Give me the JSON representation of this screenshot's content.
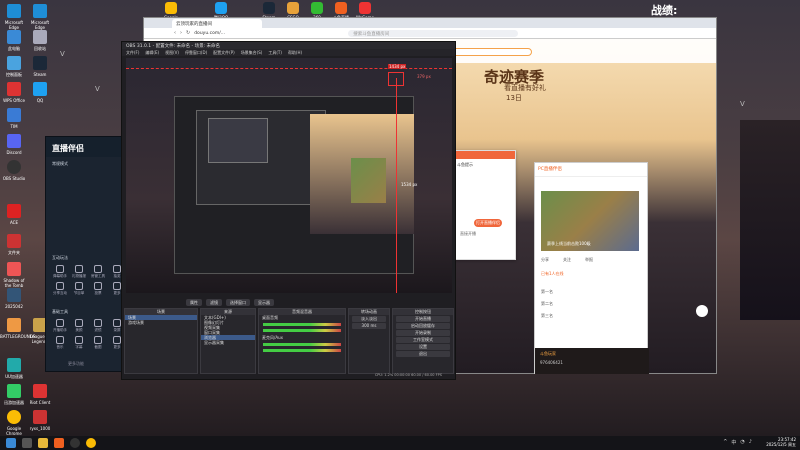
{
  "top_title": "战绩:",
  "desktop_icons_left": [
    {
      "label": "Microsoft Edge"
    },
    {
      "label": "Microsoft Edge"
    },
    {
      "label": "此电脑"
    },
    {
      "label": "回收站"
    },
    {
      "label": "控制面板"
    },
    {
      "label": "Steam"
    },
    {
      "label": "WPS Office"
    },
    {
      "label": "QQ"
    },
    {
      "label": "TIM"
    },
    {
      "label": "Discord"
    },
    {
      "label": "OBS Studio"
    },
    {
      "label": "Shadow of the Tomb"
    },
    {
      "label": "2025042"
    },
    {
      "label": "文件夹"
    },
    {
      "label": "ACE"
    },
    {
      "label": "League of Legends"
    },
    {
      "label": "BATTLEGROUNDS"
    },
    {
      "label": "UU加速器"
    },
    {
      "label": "迅游加速器"
    },
    {
      "label": "Riot Client"
    },
    {
      "label": "Google Chrome"
    },
    {
      "label": "ryxs_1000"
    }
  ],
  "desktop_icons_top": [
    {
      "label": "Google Chrome"
    },
    {
      "label": "腾讯QQ"
    },
    {
      "label": "Steam"
    },
    {
      "label": "CSGO"
    },
    {
      "label": "360"
    },
    {
      "label": "斗鱼直播"
    },
    {
      "label": "WeGame"
    }
  ],
  "browser": {
    "tab_label": "云顶玩家的直播间",
    "url": "douyu.com/...",
    "search_placeholder": "搜索斗鱼直播房间",
    "banner_title": "奇迹赛季",
    "banner_sub": "看直播有好礼",
    "banner_date": "13日"
  },
  "dialog": {
    "title": "斗鱼提示",
    "button": "打开直播伴侣",
    "hint": "直接开播"
  },
  "stream_panel": {
    "header": "PC直播伴侣",
    "video_caption": "赛季上线当前击败100级",
    "tabs": [
      "分享",
      "关注",
      "举报"
    ],
    "rank_label": "已有1人在线",
    "rows": [
      "第一名",
      "第二名",
      "第三名"
    ],
    "chat_user": "斗鱼玩家",
    "chat_id": "976406421"
  },
  "assistant": {
    "title": "直播伴侣",
    "mode_label": "常规模式",
    "section1": "互动玩法",
    "section2": "基础工具",
    "grid1": [
      "弹幕助手",
      "礼物播报",
      "房管工具",
      "抽奖",
      "分享互动",
      "节目单",
      "投票",
      "更多"
    ],
    "grid2": [
      "开播助手",
      "美颜",
      "滤镜",
      "录屏",
      "音乐",
      "字幕",
      "截图",
      "更多"
    ],
    "footer": "更多功能"
  },
  "obs": {
    "title": "OBS 31.0.1 - 配置文件: 未命名 - 场景: 未命名",
    "menu": [
      "文件(F)",
      "编辑(E)",
      "视图(V)",
      "停靠窗口(D)",
      "配置文件(P)",
      "场景集合(S)",
      "工具(T)",
      "帮助(H)"
    ],
    "preview_labels": {
      "box": "1434 px",
      "top": "379 px",
      "side": "1534 px"
    },
    "toolbar": [
      "属性",
      "滤镜",
      "选择窗口",
      "显示器"
    ],
    "scenes_title": "场景",
    "scenes": [
      "场景",
      "游戏场景"
    ],
    "sources_title": "来源",
    "sources": [
      "文本(GDI+)",
      "图像幻灯片",
      "视频采集",
      "窗口采集",
      "浏览器",
      "显示器采集"
    ],
    "mixer_title": "音频混音器",
    "mixer_tracks": [
      "桌面音频",
      "麦克风/Aux"
    ],
    "transitions_title": "转场动画",
    "transition_type": "淡入淡出",
    "transition_duration": "300 ms",
    "controls_title": "控制按钮",
    "controls": [
      "开始直播",
      "启动回放缓存",
      "开始录制",
      "工作室模式",
      "设置",
      "退出"
    ],
    "status": "CPU: 1.2%   00:00:00   60.00 / 60.00 FPS"
  },
  "taskbar": {
    "time": "23:57:42",
    "date": "2025/12/5 周五",
    "lang": "中"
  }
}
